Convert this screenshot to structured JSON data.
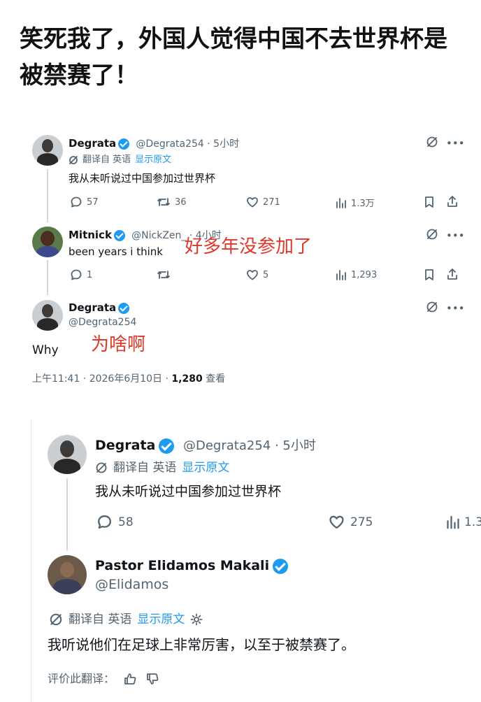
{
  "title": "笑死我了，外国人觉得中国不去世界杯是被禁赛了！",
  "tweet1": {
    "name": "Degrata",
    "handle_time": "@Degrata254 · 5小时",
    "translated_from": "翻译自 英语",
    "show_original": "显示原文",
    "text": "我从未听说过中国参加过世界杯",
    "replies": "57",
    "retweets": "36",
    "likes": "271",
    "views": "1.3万"
  },
  "tweet2": {
    "name": "Mitnick",
    "handle_time": "@NickZen_ · 4小时",
    "text": "been years i think",
    "overlay": "好多年没参加了",
    "replies": "1",
    "likes": "5",
    "views": "1,293"
  },
  "tweet3": {
    "name": "Degrata",
    "handle": "@Degrata254",
    "text": "Why",
    "overlay": "为啥啊",
    "timestamp": "上午11:41 · 2026年6月10日 · ",
    "view_count": "1,280",
    "view_label": " 查看"
  },
  "card": {
    "tweet1": {
      "name": "Degrata",
      "handle_time": "@Degrata254 · 5小时",
      "translated_from": "翻译自 英语",
      "show_original": "显示原文",
      "text": "我从未听说过中国参加过世界杯",
      "replies": "58",
      "likes": "275",
      "views": "1.3"
    },
    "tweet2": {
      "name": "Pastor Elidamos Makali",
      "handle": "@Elidamos",
      "translated_from": "翻译自 英语",
      "show_original": "显示原文",
      "text": "我听说他们在足球上非常厉害，以至于被禁赛了。",
      "rate_label": "评价此翻译："
    }
  },
  "colors": {
    "accent": "#1d9bf0",
    "overlay_red": "#e0372b",
    "muted": "#536471"
  }
}
